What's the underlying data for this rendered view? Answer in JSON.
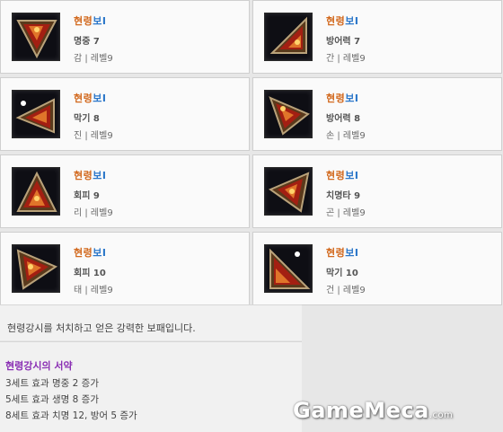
{
  "items": [
    {
      "name_a": "현령",
      "name_b": "보",
      "badge": "I",
      "stat": "명중 7",
      "level": "감 | 레벨9"
    },
    {
      "name_a": "현령",
      "name_b": "보",
      "badge": "I",
      "stat": "방어력 7",
      "level": "간 | 레벨9"
    },
    {
      "name_a": "현령",
      "name_b": "보",
      "badge": "I",
      "stat": "막기 8",
      "level": "진 | 레벨9"
    },
    {
      "name_a": "현령",
      "name_b": "보",
      "badge": "I",
      "stat": "방어력 8",
      "level": "손 | 레벨9"
    },
    {
      "name_a": "현령",
      "name_b": "보",
      "badge": "I",
      "stat": "회피 9",
      "level": "리 | 레벨9"
    },
    {
      "name_a": "현령",
      "name_b": "보",
      "badge": "I",
      "stat": "치명타 9",
      "level": "곤 | 레벨9"
    },
    {
      "name_a": "현령",
      "name_b": "보",
      "badge": "I",
      "stat": "회피 10",
      "level": "태 | 레벨9"
    },
    {
      "name_a": "현령",
      "name_b": "보",
      "badge": "I",
      "stat": "막기 10",
      "level": "건 | 레벨9"
    }
  ],
  "description": "현령강시를 처치하고 얻은 강력한 보패입니다.",
  "set_bonus": {
    "title": "현령강시의 서약",
    "lines": [
      "3세트 효과 명중 2 증가",
      "5세트 효과 생명 8 증가",
      "8세트 효과 치명 12, 방어 5 증가"
    ]
  },
  "watermark": {
    "main": "GameMeca",
    "suffix": ".com"
  }
}
